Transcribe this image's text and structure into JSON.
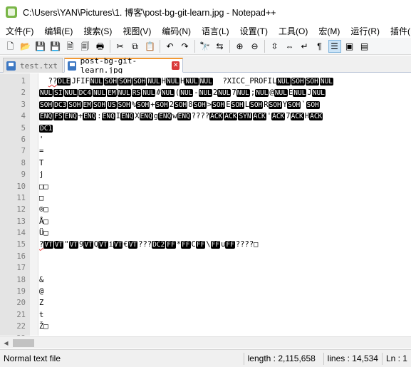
{
  "window": {
    "title": "C:\\Users\\YAN\\Pictures\\1. 博客\\post-bg-git-learn.jpg - Notepad++"
  },
  "menu": [
    "文件(F)",
    "编辑(E)",
    "搜索(S)",
    "视图(V)",
    "编码(N)",
    "语言(L)",
    "设置(T)",
    "工具(O)",
    "宏(M)",
    "运行(R)",
    "插件(P)"
  ],
  "toolbar": {
    "buttons": [
      {
        "name": "new-file-icon",
        "glyph": "🗋"
      },
      {
        "name": "open-file-icon",
        "glyph": "📂"
      },
      {
        "name": "save-icon",
        "glyph": "💾"
      },
      {
        "name": "save-all-icon",
        "glyph": "💾"
      },
      {
        "name": "close-icon",
        "glyph": "🗎"
      },
      {
        "name": "close-all-icon",
        "glyph": "🗐"
      },
      {
        "name": "print-icon",
        "glyph": "🖶"
      },
      {
        "sep": true
      },
      {
        "name": "cut-icon",
        "glyph": "✂"
      },
      {
        "name": "copy-icon",
        "glyph": "⧉"
      },
      {
        "name": "paste-icon",
        "glyph": "📋"
      },
      {
        "sep": true
      },
      {
        "name": "undo-icon",
        "glyph": "↶"
      },
      {
        "name": "redo-icon",
        "glyph": "↷"
      },
      {
        "sep": true
      },
      {
        "name": "find-icon",
        "glyph": "🔭"
      },
      {
        "name": "replace-icon",
        "glyph": "⇆"
      },
      {
        "sep": true
      },
      {
        "name": "zoom-in-icon",
        "glyph": "⊕"
      },
      {
        "name": "zoom-out-icon",
        "glyph": "⊖"
      },
      {
        "sep": true
      },
      {
        "name": "sync-vertical-icon",
        "glyph": "⇳"
      },
      {
        "name": "sync-horizontal-icon",
        "glyph": "⇔"
      },
      {
        "name": "word-wrap-icon",
        "glyph": "↵"
      },
      {
        "name": "show-all-chars-icon",
        "glyph": "¶"
      },
      {
        "name": "indent-guide-icon",
        "glyph": "☰",
        "active": true
      },
      {
        "name": "user-language-icon",
        "glyph": "▣"
      },
      {
        "name": "doc-map-icon",
        "glyph": "▤"
      }
    ]
  },
  "tabs": [
    {
      "label": "test.txt",
      "active": false,
      "icon": "saved-file-icon"
    },
    {
      "label": "post-bg-git-learn.jpg",
      "active": true,
      "icon": "saved-file-icon"
    }
  ],
  "editor": {
    "lines": [
      {
        "n": "1",
        "segs": [
          {
            "t": "  ",
            "c": false
          },
          {
            "t": "??",
            "c": false,
            "sq": true
          },
          {
            "t": "DLE",
            "c": true
          },
          {
            "t": "JFIF",
            "c": false
          },
          {
            "t": "NUL",
            "c": true
          },
          {
            "t": "SOH",
            "c": true
          },
          {
            "t": "SOH",
            "c": true
          },
          {
            "t": "SOH",
            "c": true
          },
          {
            "t": "NUL",
            "c": true
          },
          {
            "t": "H",
            "c": false
          },
          {
            "t": "NUL",
            "c": true
          },
          {
            "t": "H",
            "c": false
          },
          {
            "t": "NUL",
            "c": true
          },
          {
            "t": "NUL",
            "c": true
          },
          {
            "t": "  ?XICC_PROFIL",
            "c": false
          },
          {
            "t": "NUL",
            "c": true
          },
          {
            "t": "SOH",
            "c": true
          },
          {
            "t": "SOH",
            "c": true
          },
          {
            "t": "NUL",
            "c": true
          }
        ]
      },
      {
        "n": "2",
        "segs": [
          {
            "t": "NUL",
            "c": true
          },
          {
            "t": "SI",
            "c": true
          },
          {
            "t": "NUL",
            "c": true
          },
          {
            "t": "DC4",
            "c": true
          },
          {
            "t": "NUL",
            "c": true
          },
          {
            "t": "EM",
            "c": true
          },
          {
            "t": "NUL",
            "c": true
          },
          {
            "t": "RS",
            "c": true
          },
          {
            "t": "NUL",
            "c": true
          },
          {
            "t": "#",
            "c": false
          },
          {
            "t": "NUL",
            "c": true
          },
          {
            "t": "(",
            "c": false
          },
          {
            "t": "NUL",
            "c": true
          },
          {
            "t": "-",
            "c": false
          },
          {
            "t": "NUL",
            "c": true
          },
          {
            "t": "2",
            "c": false
          },
          {
            "t": "NUL",
            "c": true
          },
          {
            "t": "7",
            "c": false
          },
          {
            "t": "NUL",
            "c": true
          },
          {
            "t": ";",
            "c": false
          },
          {
            "t": "NUL",
            "c": true
          },
          {
            "t": "@",
            "c": false
          },
          {
            "t": "NUL",
            "c": true
          },
          {
            "t": "E",
            "c": false
          },
          {
            "t": "NUL",
            "c": true
          },
          {
            "t": "J",
            "c": false
          },
          {
            "t": "NUL",
            "c": true
          }
        ]
      },
      {
        "n": "3",
        "segs": [
          {
            "t": "SOH",
            "c": true
          },
          {
            "t": "DC3",
            "c": true
          },
          {
            "t": "SOH",
            "c": true
          },
          {
            "t": "EM",
            "c": true
          },
          {
            "t": "SOH",
            "c": true
          },
          {
            "t": "US",
            "c": true
          },
          {
            "t": "SOH",
            "c": true
          },
          {
            "t": "%",
            "c": false
          },
          {
            "t": "SOH",
            "c": true
          },
          {
            "t": "+",
            "c": false
          },
          {
            "t": "SOH",
            "c": true
          },
          {
            "t": "2",
            "c": false
          },
          {
            "t": "SOH",
            "c": true
          },
          {
            "t": "8",
            "c": false
          },
          {
            "t": "SOH",
            "c": true
          },
          {
            "t": ">",
            "c": false
          },
          {
            "t": "SOH",
            "c": true
          },
          {
            "t": "E",
            "c": false
          },
          {
            "t": "SOH",
            "c": true
          },
          {
            "t": "L",
            "c": false
          },
          {
            "t": "SOH",
            "c": true
          },
          {
            "t": "R",
            "c": false
          },
          {
            "t": "SOH",
            "c": true
          },
          {
            "t": "Y",
            "c": false
          },
          {
            "t": "SOH",
            "c": true
          },
          {
            "t": "`",
            "c": false
          },
          {
            "t": "SOH",
            "c": true
          }
        ]
      },
      {
        "n": "4",
        "segs": [
          {
            "t": "ENQ",
            "c": true
          },
          {
            "t": "FS",
            "c": true
          },
          {
            "t": "ENQ",
            "c": true
          },
          {
            "t": "+",
            "c": false
          },
          {
            "t": "ENQ",
            "c": true
          },
          {
            "t": ":",
            "c": false
          },
          {
            "t": "ENQ",
            "c": true
          },
          {
            "t": "I",
            "c": false
          },
          {
            "t": "ENQ",
            "c": true
          },
          {
            "t": "X",
            "c": false
          },
          {
            "t": "ENQ",
            "c": true
          },
          {
            "t": "g",
            "c": false
          },
          {
            "t": "ENQ",
            "c": true
          },
          {
            "t": "w",
            "c": false
          },
          {
            "t": "ENQ",
            "c": true
          },
          {
            "t": "????",
            "c": false
          },
          {
            "t": "ACK",
            "c": true
          },
          {
            "t": "ACK",
            "c": true
          },
          {
            "t": "SYN",
            "c": true
          },
          {
            "t": "ACK",
            "c": true
          },
          {
            "t": "'",
            "c": false
          },
          {
            "t": "ACK",
            "c": true
          },
          {
            "t": "7",
            "c": false
          },
          {
            "t": "ACK",
            "c": true
          },
          {
            "t": "H",
            "c": false
          },
          {
            "t": "ACK",
            "c": true
          }
        ]
      },
      {
        "n": "5",
        "segs": [
          {
            "t": "DC1",
            "c": true
          }
        ]
      },
      {
        "n": "6",
        "segs": [
          {
            "t": "'",
            "c": false
          }
        ]
      },
      {
        "n": "7",
        "segs": [
          {
            "t": "=",
            "c": false
          }
        ]
      },
      {
        "n": "8",
        "segs": [
          {
            "t": "T",
            "c": false
          }
        ]
      },
      {
        "n": "9",
        "segs": [
          {
            "t": "j",
            "c": false
          }
        ]
      },
      {
        "n": "10",
        "segs": [
          {
            "t": "□□",
            "c": false
          }
        ]
      },
      {
        "n": "11",
        "segs": [
          {
            "t": "□",
            "c": false
          }
        ]
      },
      {
        "n": "12",
        "segs": [
          {
            "t": "®□",
            "c": false
          }
        ]
      },
      {
        "n": "13",
        "segs": [
          {
            "t": "Å□",
            "c": false
          }
        ]
      },
      {
        "n": "14",
        "segs": [
          {
            "t": "Ü□",
            "c": false
          }
        ]
      },
      {
        "n": "15",
        "segs": [
          {
            "t": "?",
            "c": false,
            "sq": true
          },
          {
            "t": "VT",
            "c": true
          },
          {
            "t": "VT",
            "c": true
          },
          {
            "t": "\"",
            "c": false
          },
          {
            "t": "VT",
            "c": true
          },
          {
            "t": "9",
            "c": false
          },
          {
            "t": "VT",
            "c": true
          },
          {
            "t": "Q",
            "c": false
          },
          {
            "t": "VT",
            "c": true
          },
          {
            "t": "i",
            "c": false
          },
          {
            "t": "VT",
            "c": true
          },
          {
            "t": "€",
            "c": false
          },
          {
            "t": "VT",
            "c": true
          },
          {
            "t": "???",
            "c": false
          },
          {
            "t": "DC2",
            "c": true
          },
          {
            "t": "FF",
            "c": true
          },
          {
            "t": "*",
            "c": false
          },
          {
            "t": "FF",
            "c": true
          },
          {
            "t": "C",
            "c": false
          },
          {
            "t": "FF",
            "c": true
          },
          {
            "t": "\\",
            "c": false
          },
          {
            "t": "FF",
            "c": true
          },
          {
            "t": "u",
            "c": false
          },
          {
            "t": "FF",
            "c": true
          },
          {
            "t": "????□",
            "c": false
          }
        ]
      },
      {
        "n": "16",
        "segs": []
      },
      {
        "n": "17",
        "segs": []
      },
      {
        "n": "18",
        "segs": [
          {
            "t": "&",
            "c": false
          }
        ]
      },
      {
        "n": "19",
        "segs": [
          {
            "t": "@",
            "c": false
          }
        ]
      },
      {
        "n": "20",
        "segs": [
          {
            "t": "Z",
            "c": false
          }
        ]
      },
      {
        "n": "21",
        "segs": [
          {
            "t": "t",
            "c": false
          }
        ]
      },
      {
        "n": "22",
        "segs": [
          {
            "t": "Ž□",
            "c": false
          }
        ]
      },
      {
        "n": "23",
        "segs": [
          {
            "t": "©□",
            "c": false
          }
        ]
      }
    ]
  },
  "status": {
    "file_type": "Normal text file",
    "length": "length : 2,115,658",
    "lines": "lines : 14,534",
    "position": "Ln : 1"
  }
}
